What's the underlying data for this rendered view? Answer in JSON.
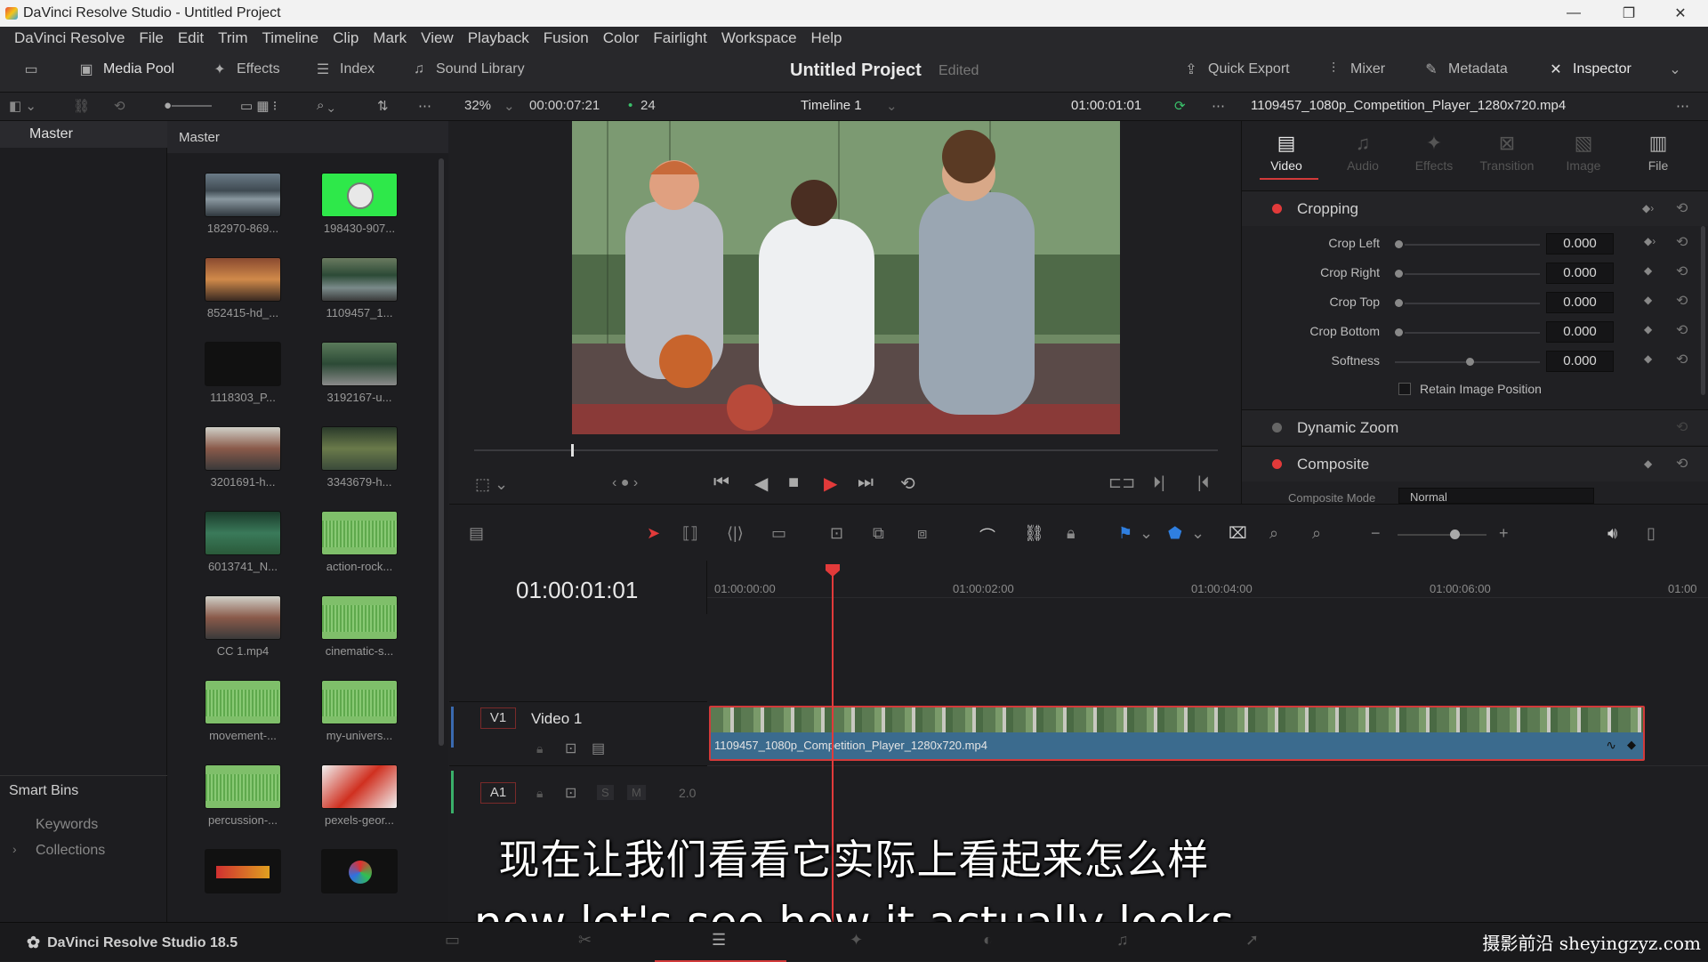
{
  "window": {
    "title": "DaVinci Resolve Studio - Untitled Project"
  },
  "menu": [
    "DaVinci Resolve",
    "File",
    "Edit",
    "Trim",
    "Timeline",
    "Clip",
    "Mark",
    "View",
    "Playback",
    "Fusion",
    "Color",
    "Fairlight",
    "Workspace",
    "Help"
  ],
  "toolbar": {
    "media_pool": "Media Pool",
    "effects": "Effects",
    "index": "Index",
    "sound_library": "Sound Library",
    "project_title": "Untitled Project",
    "project_status": "Edited",
    "quick_export": "Quick Export",
    "mixer": "Mixer",
    "metadata": "Metadata",
    "inspector": "Inspector"
  },
  "viewer_bar": {
    "zoom": "32%",
    "duration": "00:00:07:21",
    "fps": "24",
    "timeline_name": "Timeline 1",
    "timecode": "01:00:01:01",
    "clip_name": "1109457_1080p_Competition_Player_1280x720.mp4"
  },
  "left_panel": {
    "master": "Master",
    "smart_bins": "Smart Bins",
    "keywords": "Keywords",
    "collections": "Collections"
  },
  "media_pool": {
    "header": "Master",
    "clips": [
      {
        "name": "182970-869...",
        "thumb": "video-water"
      },
      {
        "name": "198430-907...",
        "thumb": "green-screen-clock"
      },
      {
        "name": "852415-hd_...",
        "thumb": "video-room"
      },
      {
        "name": "1109457_1...",
        "thumb": "video-basketball"
      },
      {
        "name": "1118303_P...",
        "thumb": "black"
      },
      {
        "name": "3192167-u...",
        "thumb": "video-street"
      },
      {
        "name": "3201691-h...",
        "thumb": "video-window"
      },
      {
        "name": "3343679-h...",
        "thumb": "video-forest"
      },
      {
        "name": "6013741_N...",
        "thumb": "video-waterfall"
      },
      {
        "name": "action-rock...",
        "thumb": "audio"
      },
      {
        "name": "CC 1.mp4",
        "thumb": "video-window"
      },
      {
        "name": "cinematic-s...",
        "thumb": "audio"
      },
      {
        "name": "movement-...",
        "thumb": "audio"
      },
      {
        "name": "my-univers...",
        "thumb": "audio"
      },
      {
        "name": "percussion-...",
        "thumb": "audio"
      },
      {
        "name": "pexels-geor...",
        "thumb": "photo"
      },
      {
        "name": "",
        "thumb": "graphic-red"
      },
      {
        "name": "",
        "thumb": "graphic-color"
      }
    ]
  },
  "inspector": {
    "tabs": [
      {
        "label": "Video",
        "icon": "video-icon",
        "active": true
      },
      {
        "label": "Audio",
        "icon": "audio-icon",
        "active": false
      },
      {
        "label": "Effects",
        "icon": "effects-icon",
        "active": false
      },
      {
        "label": "Transition",
        "icon": "transition-icon",
        "active": false
      },
      {
        "label": "Image",
        "icon": "image-icon",
        "active": false
      },
      {
        "label": "File",
        "icon": "file-icon",
        "active": true
      }
    ],
    "cropping": {
      "title": "Cropping",
      "params": [
        {
          "label": "Crop Left",
          "value": "0.000"
        },
        {
          "label": "Crop Right",
          "value": "0.000"
        },
        {
          "label": "Crop Top",
          "value": "0.000"
        },
        {
          "label": "Crop Bottom",
          "value": "0.000"
        },
        {
          "label": "Softness",
          "value": "0.000"
        }
      ],
      "retain": "Retain Image Position"
    },
    "dynamic_zoom": "Dynamic Zoom",
    "composite": "Composite",
    "composite_mode_label": "Composite Mode",
    "composite_mode_value": "Normal"
  },
  "timeline": {
    "timecode": "01:00:01:01",
    "ruler": [
      "01:00:00:00",
      "01:00:02:00",
      "01:00:04:00",
      "01:00:06:00",
      "01:00"
    ],
    "video_track": {
      "badge": "V1",
      "name": "Video 1",
      "clip": "1109457_1080p_Competition_Player_1280x720.mp4"
    },
    "audio_track": {
      "badge": "A1",
      "level": "2.0",
      "solo": "S",
      "mute": "M"
    }
  },
  "subtitles": {
    "zh": "现在让我们看看它实际上看起来怎么样",
    "en": "now let's see how it actually looks"
  },
  "bottom": {
    "app_name": "DaVinci Resolve Studio 18.5",
    "watermark": "摄影前沿 sheyingzyz.com"
  },
  "colors": {
    "accent_red": "#e23a3a",
    "clip_blue": "#3b6b8e",
    "active_tab": "#d23a3a"
  }
}
